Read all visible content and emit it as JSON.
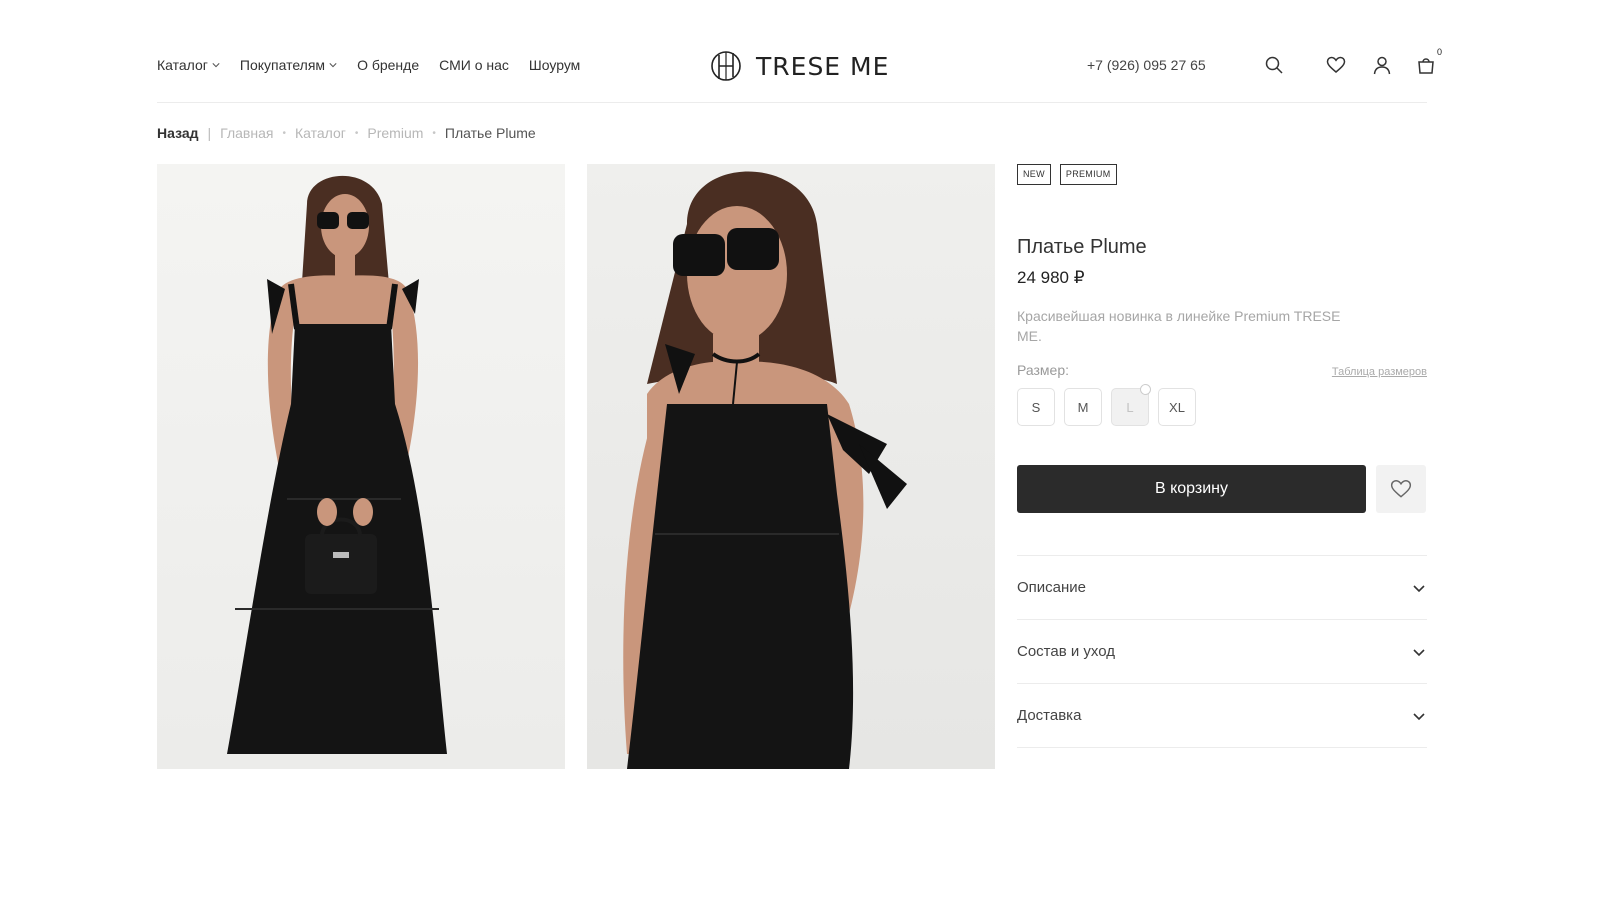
{
  "header": {
    "nav": [
      {
        "label": "Каталог",
        "has_dropdown": true
      },
      {
        "label": "Покупателям",
        "has_dropdown": true
      },
      {
        "label": "О бренде",
        "has_dropdown": false
      },
      {
        "label": "СМИ о нас",
        "has_dropdown": false
      },
      {
        "label": "Шоурум",
        "has_dropdown": false
      }
    ],
    "logo_text": "TRESE ME",
    "phone": "+7 (926) 095 27 65",
    "icons": [
      "search-icon",
      "heart-icon",
      "user-icon",
      "bag-icon"
    ],
    "cart_count": "0"
  },
  "breadcrumb": {
    "back": "Назад",
    "separator": "|",
    "items": [
      "Главная",
      "Каталог",
      "Premium"
    ],
    "current": "Платье Plume"
  },
  "product": {
    "badges": [
      "NEW",
      "PREMIUM"
    ],
    "title": "Платье Plume",
    "price": "24 980 ₽",
    "description": "Красивейшая новинка в линейке Premium TRESE ME.",
    "size_label": "Размер:",
    "size_table_link": "Таблица размеров",
    "sizes": [
      {
        "label": "S",
        "available": true
      },
      {
        "label": "M",
        "available": true
      },
      {
        "label": "L",
        "available": false
      },
      {
        "label": "XL",
        "available": true
      }
    ],
    "add_to_cart": "В корзину",
    "accordion": [
      "Описание",
      "Состав и уход",
      "Доставка"
    ]
  },
  "colors": {
    "button_dark": "#2b2b2b",
    "text_muted": "#a6a6a6",
    "divider": "#ececec"
  }
}
